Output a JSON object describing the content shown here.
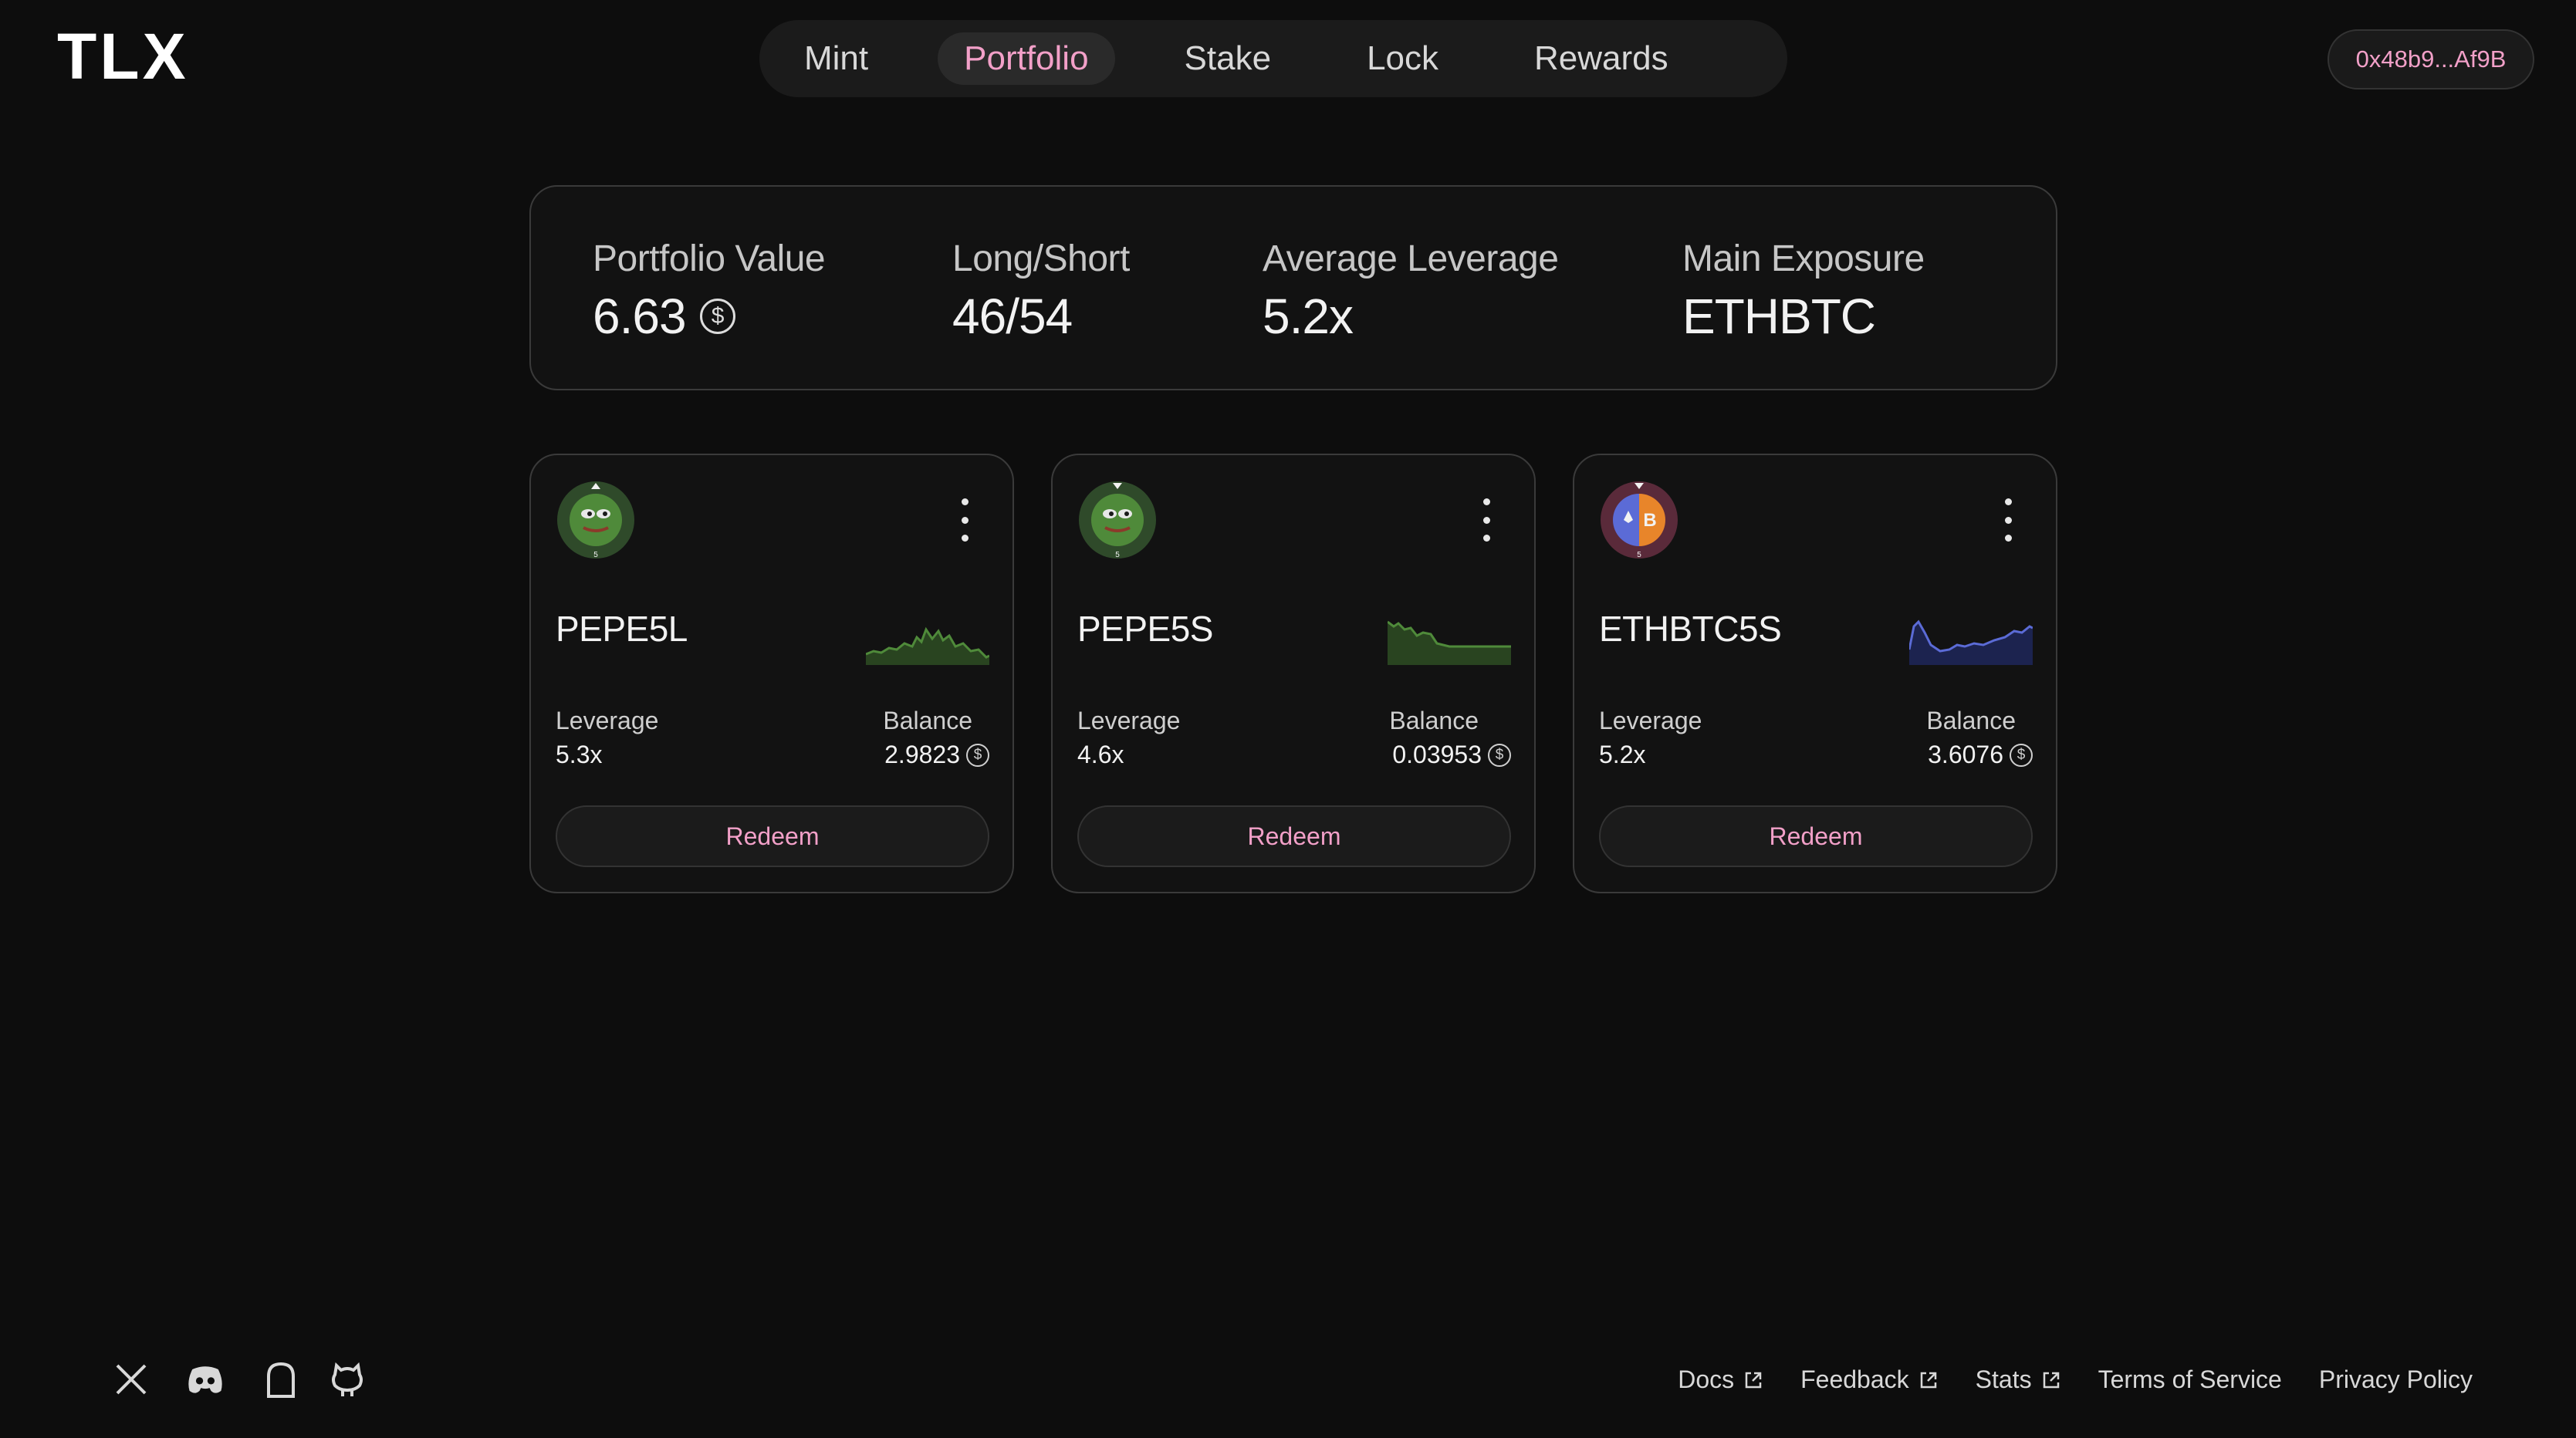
{
  "header": {
    "logo_text": "TLX",
    "nav": [
      {
        "label": "Mint",
        "active": false
      },
      {
        "label": "Portfolio",
        "active": true
      },
      {
        "label": "Stake",
        "active": false
      },
      {
        "label": "Lock",
        "active": false
      },
      {
        "label": "Rewards",
        "active": false
      }
    ],
    "wallet_address": "0x48b9...Af9B"
  },
  "summary": {
    "portfolio_value_label": "Portfolio Value",
    "portfolio_value": "6.63",
    "long_short_label": "Long/Short",
    "long_short": "46/54",
    "avg_leverage_label": "Average Leverage",
    "avg_leverage": "5.2x",
    "main_exposure_label": "Main Exposure",
    "main_exposure": "ETHBTC"
  },
  "positions": [
    {
      "name": "PEPE5L",
      "leverage_label": "Leverage",
      "leverage": "5.3x",
      "balance_label": "Balance",
      "balance": "2.9823",
      "action": "Redeem",
      "icon": "pepe-long-icon",
      "chart_color": "#4f8a3a"
    },
    {
      "name": "PEPE5S",
      "leverage_label": "Leverage",
      "leverage": "4.6x",
      "balance_label": "Balance",
      "balance": "0.03953",
      "action": "Redeem",
      "icon": "pepe-short-icon",
      "chart_color": "#4f8a3a"
    },
    {
      "name": "ETHBTC5S",
      "leverage_label": "Leverage",
      "leverage": "5.2x",
      "balance_label": "Balance",
      "balance": "3.6076",
      "action": "Redeem",
      "icon": "ethbtc-short-icon",
      "chart_color": "#5b6bd6"
    }
  ],
  "footer": {
    "social": [
      "x-icon",
      "discord-icon",
      "mirror-icon",
      "github-icon"
    ],
    "links": [
      {
        "label": "Docs",
        "external": true
      },
      {
        "label": "Feedback",
        "external": true
      },
      {
        "label": "Stats",
        "external": true
      },
      {
        "label": "Terms of Service",
        "external": false
      },
      {
        "label": "Privacy Policy",
        "external": false
      }
    ]
  },
  "colors": {
    "accent": "#f2a0c8",
    "background": "#0d0d0d",
    "panel": "#121212",
    "border": "#3a3a3a"
  }
}
